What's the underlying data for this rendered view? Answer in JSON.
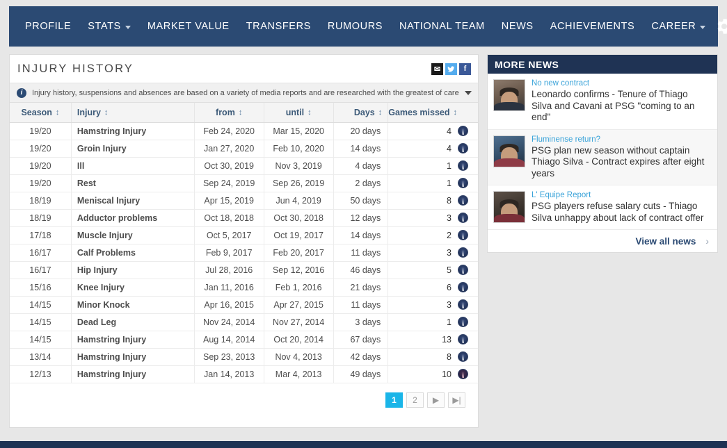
{
  "nav": {
    "items": [
      {
        "label": "PROFILE",
        "caret": false
      },
      {
        "label": "STATS",
        "caret": true
      },
      {
        "label": "MARKET VALUE",
        "caret": false
      },
      {
        "label": "TRANSFERS",
        "caret": false
      },
      {
        "label": "RUMOURS",
        "caret": false
      },
      {
        "label": "NATIONAL TEAM",
        "caret": false
      },
      {
        "label": "NEWS",
        "caret": false
      },
      {
        "label": "ACHIEVEMENTS",
        "caret": false
      },
      {
        "label": "CAREER",
        "caret": true
      }
    ],
    "settings_icon": "gear-icon"
  },
  "panel": {
    "title": "INJURY HISTORY",
    "share": [
      {
        "name": "mail-icon",
        "glyph": "✉"
      },
      {
        "name": "twitter-icon",
        "glyph": "т"
      },
      {
        "name": "facebook-icon",
        "glyph": "f"
      }
    ],
    "info_icon": "info-icon",
    "info_text": "Injury history, suspensions and absences are based on a variety of media reports and are researched with the greatest of care. If you should n...",
    "info_chevron": "chevron-down-icon"
  },
  "table": {
    "columns": [
      "Season",
      "Injury",
      "from",
      "until",
      "Days",
      "Games missed"
    ],
    "sort_glyph": "↕",
    "rows": [
      {
        "season": "19/20",
        "injury": "Hamstring Injury",
        "from": "Feb 24, 2020",
        "until": "Mar 15, 2020",
        "days": "20 days",
        "games": "4",
        "club": "psg"
      },
      {
        "season": "19/20",
        "injury": "Groin Injury",
        "from": "Jan 27, 2020",
        "until": "Feb 10, 2020",
        "days": "14 days",
        "games": "4",
        "club": "psg"
      },
      {
        "season": "19/20",
        "injury": "Ill",
        "from": "Oct 30, 2019",
        "until": "Nov 3, 2019",
        "days": "4 days",
        "games": "1",
        "club": "psg"
      },
      {
        "season": "19/20",
        "injury": "Rest",
        "from": "Sep 24, 2019",
        "until": "Sep 26, 2019",
        "days": "2 days",
        "games": "1",
        "club": "psg"
      },
      {
        "season": "18/19",
        "injury": "Meniscal Injury",
        "from": "Apr 15, 2019",
        "until": "Jun 4, 2019",
        "days": "50 days",
        "games": "8",
        "club": "psg"
      },
      {
        "season": "18/19",
        "injury": "Adductor problems",
        "from": "Oct 18, 2018",
        "until": "Oct 30, 2018",
        "days": "12 days",
        "games": "3",
        "club": "psg"
      },
      {
        "season": "17/18",
        "injury": "Muscle Injury",
        "from": "Oct 5, 2017",
        "until": "Oct 19, 2017",
        "days": "14 days",
        "games": "2",
        "club": "psg"
      },
      {
        "season": "16/17",
        "injury": "Calf Problems",
        "from": "Feb 9, 2017",
        "until": "Feb 20, 2017",
        "days": "11 days",
        "games": "3",
        "club": "psg"
      },
      {
        "season": "16/17",
        "injury": "Hip Injury",
        "from": "Jul 28, 2016",
        "until": "Sep 12, 2016",
        "days": "46 days",
        "games": "5",
        "club": "psg"
      },
      {
        "season": "15/16",
        "injury": "Knee Injury",
        "from": "Jan 11, 2016",
        "until": "Feb 1, 2016",
        "days": "21 days",
        "games": "6",
        "club": "psg"
      },
      {
        "season": "14/15",
        "injury": "Minor Knock",
        "from": "Apr 16, 2015",
        "until": "Apr 27, 2015",
        "days": "11 days",
        "games": "3",
        "club": "psg"
      },
      {
        "season": "14/15",
        "injury": "Dead Leg",
        "from": "Nov 24, 2014",
        "until": "Nov 27, 2014",
        "days": "3 days",
        "games": "1",
        "club": "psg"
      },
      {
        "season": "14/15",
        "injury": "Hamstring Injury",
        "from": "Aug 14, 2014",
        "until": "Oct 20, 2014",
        "days": "67 days",
        "games": "13",
        "club": "psg"
      },
      {
        "season": "13/14",
        "injury": "Hamstring Injury",
        "from": "Sep 23, 2013",
        "until": "Nov 4, 2013",
        "days": "42 days",
        "games": "8",
        "club": "psg"
      },
      {
        "season": "12/13",
        "injury": "Hamstring Injury",
        "from": "Jan 14, 2013",
        "until": "Mar 4, 2013",
        "days": "49 days",
        "games": "10",
        "club": "psg-alt"
      }
    ]
  },
  "pagination": {
    "pages": [
      {
        "label": "1",
        "active": true
      },
      {
        "label": "2",
        "active": false
      }
    ],
    "next_label": "▶",
    "last_label": "▶|"
  },
  "news": {
    "header": "MORE NEWS",
    "items": [
      {
        "kicker": "No new contract",
        "title": "Leonardo confirms - Tenure of Thiago Silva and Cavani at PSG \"coming to an end\"",
        "thumb": "news-thumbnail-1"
      },
      {
        "kicker": "Fluminense return?",
        "title": "PSG plan new season without captain Thiago Silva - Contract expires after eight years",
        "thumb": "news-thumbnail-2"
      },
      {
        "kicker": "L' Equipe Report",
        "title": "PSG players refuse salary cuts - Thiago Silva unhappy about lack of contract offer",
        "thumb": "news-thumbnail-3"
      }
    ],
    "view_all_label": "View all news",
    "view_all_chevron": "›"
  },
  "colors": {
    "nav_bg": "#2b4a73",
    "news_header_bg": "#1f3354",
    "accent_cyan": "#1ab5e8",
    "link_blue": "#3aa3d9",
    "page_bg": "#e7e7e7"
  }
}
